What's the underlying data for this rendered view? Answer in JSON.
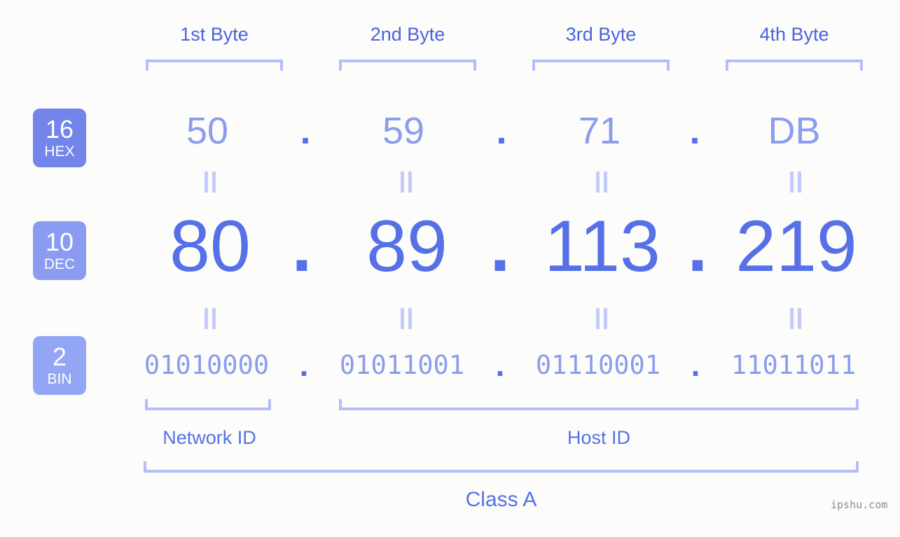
{
  "page": {
    "background_color": "#fcfdfa",
    "watermark": "ipshu.com"
  },
  "colors": {
    "accent_dark": "#5670e8",
    "accent_mid": "#8c9cee",
    "accent_light": "#b4bdfa",
    "badge_hex": "#7384ea",
    "badge_dec": "#8b9bf2",
    "badge_bin": "#93a5f5",
    "header_text": "#4a63e0",
    "watermark_text": "#8d8d8d"
  },
  "byte_headers": [
    {
      "label": "1st Byte"
    },
    {
      "label": "2nd Byte"
    },
    {
      "label": "3rd Byte"
    },
    {
      "label": "4th Byte"
    }
  ],
  "bases": {
    "hex": {
      "number": "16",
      "name": "HEX"
    },
    "dec": {
      "number": "10",
      "name": "DEC"
    },
    "bin": {
      "number": "2",
      "name": "BIN"
    }
  },
  "rows": {
    "hex": {
      "values": [
        "50",
        "59",
        "71",
        "DB"
      ],
      "separator": "."
    },
    "dec": {
      "values": [
        "80",
        "89",
        "113",
        "219"
      ],
      "separator": "."
    },
    "bin": {
      "values": [
        "01010000",
        "01011001",
        "01110001",
        "11011011"
      ],
      "separator": "."
    }
  },
  "equality_marks": {
    "symbol": "=",
    "count_per_row": 4
  },
  "sections": {
    "network_id": {
      "label": "Network ID"
    },
    "host_id": {
      "label": "Host ID"
    },
    "class": {
      "label": "Class A"
    }
  },
  "address": {
    "decimal": "80.89.113.219",
    "hex": "50.59.71.DB",
    "binary": "01010000.01011001.01110001.11011011"
  }
}
